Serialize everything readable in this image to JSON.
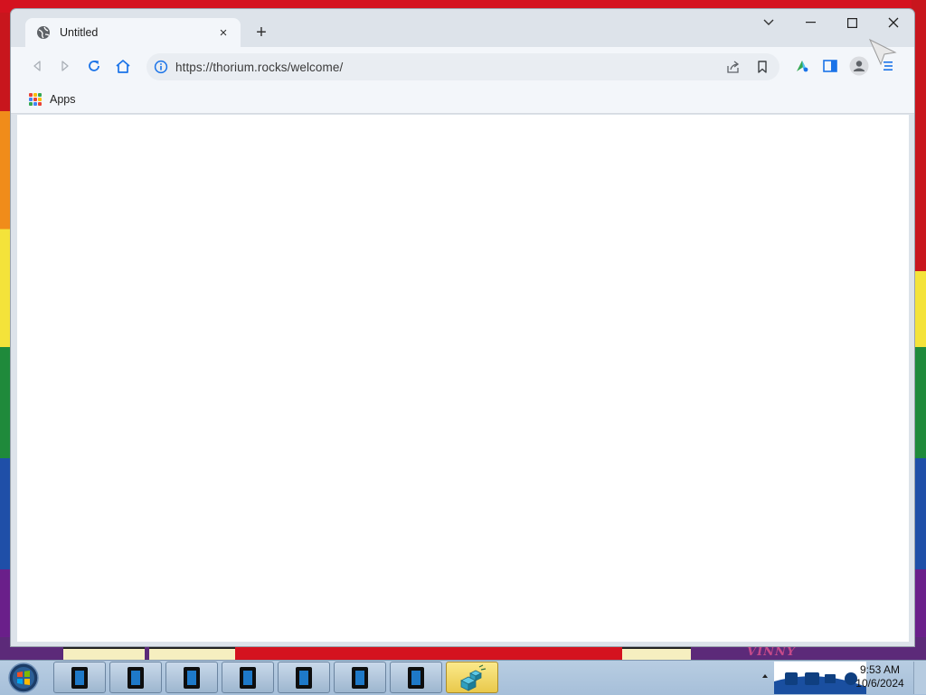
{
  "browser": {
    "tab_title": "Untitled",
    "tab_close": "×",
    "new_tab": "+",
    "url": "https://thorium.rocks/welcome/",
    "bookmarks": {
      "apps_label": "Apps"
    }
  },
  "icons": {
    "favicon": "globe-icon",
    "back": "back-arrow-icon",
    "forward": "forward-arrow-icon",
    "reload": "reload-icon",
    "home": "home-icon",
    "site_info": "info-icon",
    "share": "share-icon",
    "bookmark": "bookmark-icon",
    "extension": "extension-icon",
    "side_panel": "side-panel-icon",
    "profile": "profile-icon",
    "menu": "menu-icon"
  },
  "colors": {
    "accent": "#1a73e8",
    "apps_grid": [
      "#ea4335",
      "#fbbc04",
      "#34a853",
      "#4285f4",
      "#ea4335",
      "#fbbc04",
      "#34a853",
      "#4285f4",
      "#ea4335"
    ]
  },
  "wallpaper": {
    "text": "VINNY"
  },
  "taskbar": {
    "time": "9:53 AM",
    "date": "10/6/2024"
  }
}
